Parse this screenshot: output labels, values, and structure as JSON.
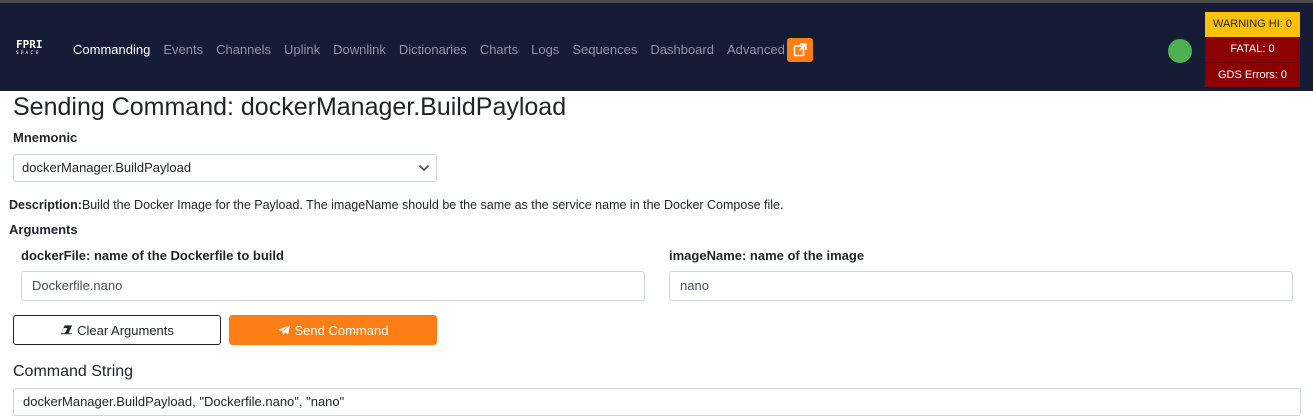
{
  "navbar": {
    "logo_text": "FPRI",
    "logo_subtext": "SPACE",
    "links": [
      {
        "label": "Commanding",
        "active": true
      },
      {
        "label": "Events",
        "active": false
      },
      {
        "label": "Channels",
        "active": false
      },
      {
        "label": "Uplink",
        "active": false
      },
      {
        "label": "Downlink",
        "active": false
      },
      {
        "label": "Dictionaries",
        "active": false
      },
      {
        "label": "Charts",
        "active": false
      },
      {
        "label": "Logs",
        "active": false
      },
      {
        "label": "Sequences",
        "active": false
      },
      {
        "label": "Dashboard",
        "active": false
      },
      {
        "label": "Advanced",
        "active": false
      }
    ],
    "external_icon": "external-link-icon",
    "status_color": "#4caf50"
  },
  "alerts": {
    "warning_hi": "WARNING HI: 0",
    "fatal": "FATAL: 0",
    "gds_errors": "GDS Errors: 0"
  },
  "page": {
    "title": "Sending Command: dockerManager.BuildPayload",
    "mnemonic_label": "Mnemonic",
    "mnemonic_value": "dockerManager.BuildPayload",
    "description_label": "Description:",
    "description_text": "Build the Docker Image for the Payload. The imageName should be the same as the service name in the Docker Compose file.",
    "arguments_label": "Arguments",
    "args": [
      {
        "label": "dockerFile: name of the Dockerfile to build",
        "value": "Dockerfile.nano"
      },
      {
        "label": "imageName: name of the image",
        "value": "nano"
      }
    ],
    "clear_button": "Clear Arguments",
    "send_button": "Send Command",
    "command_string_label": "Command String",
    "command_string_value": "dockerManager.BuildPayload, \"Dockerfile.nano\", \"nano\""
  },
  "colors": {
    "navbar_bg": "#161b36",
    "accent_orange": "#fd7e14",
    "warning_yellow": "#ffc107",
    "fatal_red": "#8b0000"
  }
}
